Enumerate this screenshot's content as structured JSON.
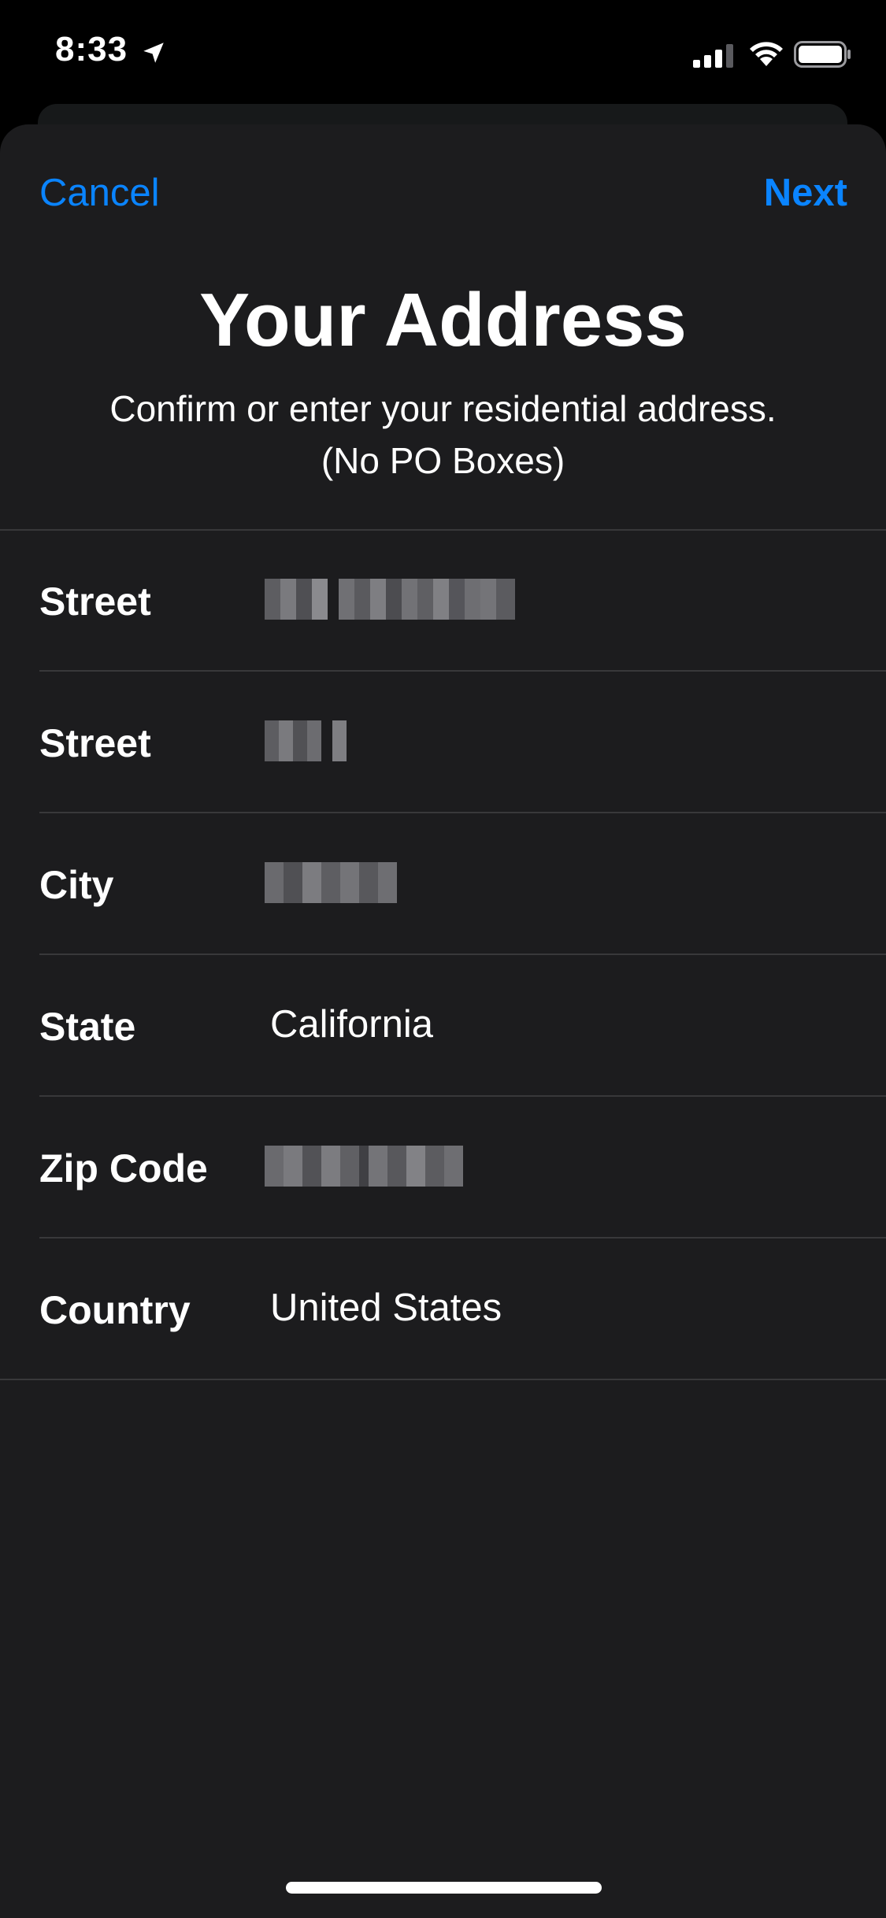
{
  "status_bar": {
    "time": "8:33",
    "location_icon": "location-arrow-icon",
    "signal_icon": "cellular-signal-icon",
    "wifi_icon": "wifi-icon",
    "battery_icon": "battery-icon"
  },
  "nav": {
    "cancel_label": "Cancel",
    "next_label": "Next"
  },
  "header": {
    "title": "Your Address",
    "subtitle_line1": "Confirm or enter your residential address.",
    "subtitle_line2": "(No PO Boxes)"
  },
  "form": {
    "rows": [
      {
        "label": "Street",
        "value": "",
        "redacted": true
      },
      {
        "label": "Street",
        "value": "",
        "redacted": true
      },
      {
        "label": "City",
        "value": "",
        "redacted": true
      },
      {
        "label": "State",
        "value": "California",
        "redacted": false
      },
      {
        "label": "Zip Code",
        "value": "",
        "redacted": true
      },
      {
        "label": "Country",
        "value": "United States",
        "redacted": false
      }
    ]
  },
  "colors": {
    "accent": "#0a84ff",
    "background": "#000000",
    "sheet": "#1c1c1e",
    "separator": "#38383a",
    "text": "#ffffff"
  }
}
